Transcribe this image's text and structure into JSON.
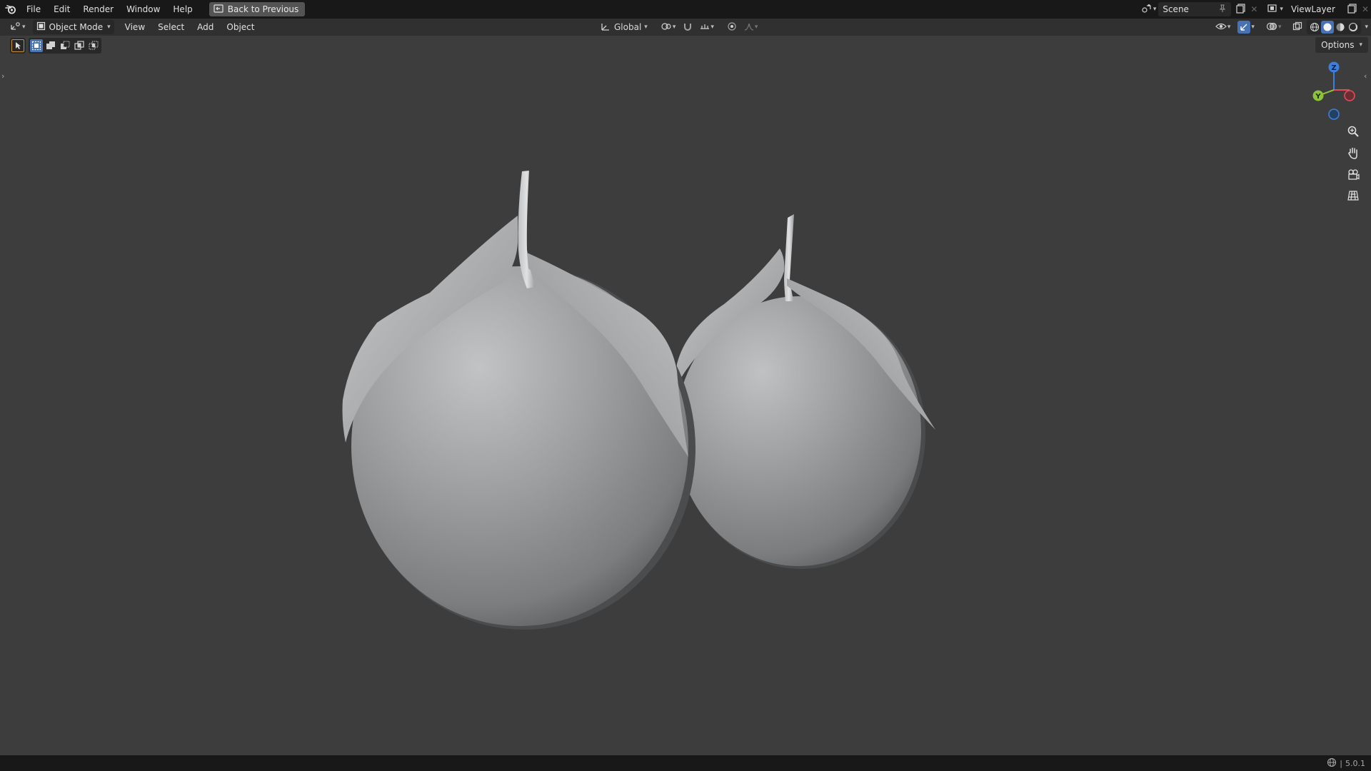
{
  "topbar": {
    "menus": [
      "File",
      "Edit",
      "Render",
      "Window",
      "Help"
    ],
    "back_label": "Back to Previous",
    "scene_name": "Scene",
    "view_layer": "ViewLayer"
  },
  "header": {
    "mode": "Object Mode",
    "menus": [
      "View",
      "Select",
      "Add",
      "Object"
    ],
    "orientation": "Global"
  },
  "toolrow": {
    "options_label": "Options"
  },
  "gizmo": {
    "z_label": "Z",
    "y_label": "Y"
  },
  "statusbar": {
    "version": "5.0.1",
    "separator": "|"
  },
  "colors": {
    "accent": "#4772b3",
    "axis_x": "#e34a5a",
    "axis_y": "#8bc33a",
    "axis_z": "#3d7fe0"
  }
}
